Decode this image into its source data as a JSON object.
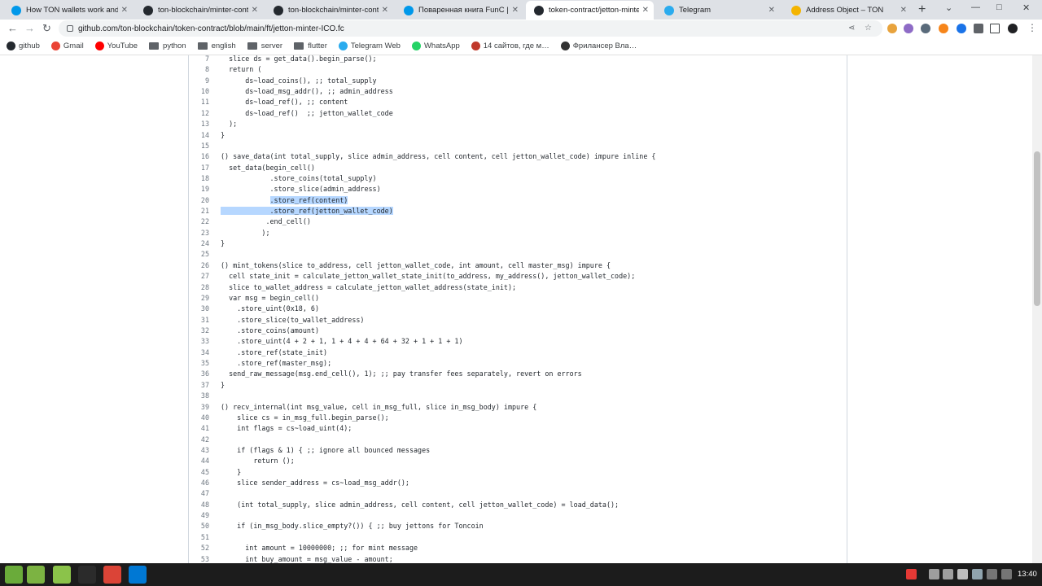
{
  "tabs": [
    {
      "title": "How TON wallets work and h…",
      "icon": "ton-icon",
      "color": "#0098ea",
      "active": false
    },
    {
      "title": "ton-blockchain/minter-contra…",
      "icon": "github-icon",
      "color": "#24292f",
      "active": false
    },
    {
      "title": "ton-blockchain/minter-contra…",
      "icon": "github-icon",
      "color": "#24292f",
      "active": false
    },
    {
      "title": "Поваренная книга FunC | От…",
      "icon": "ton-icon",
      "color": "#0098ea",
      "active": false
    },
    {
      "title": "token-contract/jetton-minter…",
      "icon": "github-icon",
      "color": "#24292f",
      "active": true
    },
    {
      "title": "Telegram",
      "icon": "telegram-icon",
      "color": "#2aabee",
      "active": false
    },
    {
      "title": "Address Object – TON",
      "icon": "hand-icon",
      "color": "#f4b400",
      "active": false
    }
  ],
  "url": "github.com/ton-blockchain/token-contract/blob/main/ft/jetton-minter-ICO.fc",
  "bookmarks": [
    {
      "label": "github",
      "icon": "github-icon",
      "color": "#24292f",
      "type": "site"
    },
    {
      "label": "Gmail",
      "icon": "gmail-icon",
      "color": "#ea4335",
      "type": "site"
    },
    {
      "label": "YouTube",
      "icon": "youtube-icon",
      "color": "#ff0000",
      "type": "site"
    },
    {
      "label": "python",
      "icon": "folder-icon",
      "color": "#5f6368",
      "type": "folder"
    },
    {
      "label": "english",
      "icon": "folder-icon",
      "color": "#5f6368",
      "type": "folder"
    },
    {
      "label": "server",
      "icon": "folder-icon",
      "color": "#5f6368",
      "type": "folder"
    },
    {
      "label": "flutter",
      "icon": "folder-icon",
      "color": "#5f6368",
      "type": "folder"
    },
    {
      "label": "Telegram Web",
      "icon": "telegram-icon",
      "color": "#2aabee",
      "type": "site"
    },
    {
      "label": "WhatsApp",
      "icon": "whatsapp-icon",
      "color": "#25d366",
      "type": "site"
    },
    {
      "label": "14 сайтов, где м…",
      "icon": "site-icon",
      "color": "#c0392b",
      "type": "site"
    },
    {
      "label": "Фрилансер Вла…",
      "icon": "site-icon",
      "color": "#333333",
      "type": "site"
    }
  ],
  "code_lines": [
    {
      "n": "7",
      "pre": "  slice ds = get_data().begin_parse();",
      "hl": "",
      "post": ""
    },
    {
      "n": "8",
      "pre": "  return (",
      "hl": "",
      "post": ""
    },
    {
      "n": "9",
      "pre": "      ds~load_coins(), ;; total_supply",
      "hl": "",
      "post": ""
    },
    {
      "n": "10",
      "pre": "      ds~load_msg_addr(), ;; admin_address",
      "hl": "",
      "post": ""
    },
    {
      "n": "11",
      "pre": "      ds~load_ref(), ;; content",
      "hl": "",
      "post": ""
    },
    {
      "n": "12",
      "pre": "      ds~load_ref()  ;; jetton_wallet_code",
      "hl": "",
      "post": ""
    },
    {
      "n": "13",
      "pre": "  );",
      "hl": "",
      "post": ""
    },
    {
      "n": "14",
      "pre": "}",
      "hl": "",
      "post": ""
    },
    {
      "n": "15",
      "pre": "",
      "hl": "",
      "post": ""
    },
    {
      "n": "16",
      "pre": "() save_data(int total_supply, slice admin_address, cell content, cell jetton_wallet_code) impure inline {",
      "hl": "",
      "post": ""
    },
    {
      "n": "17",
      "pre": "  set_data(begin_cell()",
      "hl": "",
      "post": ""
    },
    {
      "n": "18",
      "pre": "            .store_coins(total_supply)",
      "hl": "",
      "post": ""
    },
    {
      "n": "19",
      "pre": "            .store_slice(admin_address)",
      "hl": "",
      "post": ""
    },
    {
      "n": "20",
      "pre": "            ",
      "hl": ".store_ref(content)",
      "post": ""
    },
    {
      "n": "21",
      "pre": "",
      "hl": "            .store_ref(jetton_wallet_code)",
      "post": ""
    },
    {
      "n": "22",
      "pre": "           .end_cell()",
      "hl": "",
      "post": ""
    },
    {
      "n": "23",
      "pre": "          );",
      "hl": "",
      "post": ""
    },
    {
      "n": "24",
      "pre": "}",
      "hl": "",
      "post": ""
    },
    {
      "n": "25",
      "pre": "",
      "hl": "",
      "post": ""
    },
    {
      "n": "26",
      "pre": "() mint_tokens(slice to_address, cell jetton_wallet_code, int amount, cell master_msg) impure {",
      "hl": "",
      "post": ""
    },
    {
      "n": "27",
      "pre": "  cell state_init = calculate_jetton_wallet_state_init(to_address, my_address(), jetton_wallet_code);",
      "hl": "",
      "post": ""
    },
    {
      "n": "28",
      "pre": "  slice to_wallet_address = calculate_jetton_wallet_address(state_init);",
      "hl": "",
      "post": ""
    },
    {
      "n": "29",
      "pre": "  var msg = begin_cell()",
      "hl": "",
      "post": ""
    },
    {
      "n": "30",
      "pre": "    .store_uint(0x18, 6)",
      "hl": "",
      "post": ""
    },
    {
      "n": "31",
      "pre": "    .store_slice(to_wallet_address)",
      "hl": "",
      "post": ""
    },
    {
      "n": "32",
      "pre": "    .store_coins(amount)",
      "hl": "",
      "post": ""
    },
    {
      "n": "33",
      "pre": "    .store_uint(4 + 2 + 1, 1 + 4 + 4 + 64 + 32 + 1 + 1 + 1)",
      "hl": "",
      "post": ""
    },
    {
      "n": "34",
      "pre": "    .store_ref(state_init)",
      "hl": "",
      "post": ""
    },
    {
      "n": "35",
      "pre": "    .store_ref(master_msg);",
      "hl": "",
      "post": ""
    },
    {
      "n": "36",
      "pre": "  send_raw_message(msg.end_cell(), 1); ;; pay transfer fees separately, revert on errors",
      "hl": "",
      "post": ""
    },
    {
      "n": "37",
      "pre": "}",
      "hl": "",
      "post": ""
    },
    {
      "n": "38",
      "pre": "",
      "hl": "",
      "post": ""
    },
    {
      "n": "39",
      "pre": "() recv_internal(int msg_value, cell in_msg_full, slice in_msg_body) impure {",
      "hl": "",
      "post": ""
    },
    {
      "n": "40",
      "pre": "    slice cs = in_msg_full.begin_parse();",
      "hl": "",
      "post": ""
    },
    {
      "n": "41",
      "pre": "    int flags = cs~load_uint(4);",
      "hl": "",
      "post": ""
    },
    {
      "n": "42",
      "pre": "",
      "hl": "",
      "post": ""
    },
    {
      "n": "43",
      "pre": "    if (flags & 1) { ;; ignore all bounced messages",
      "hl": "",
      "post": ""
    },
    {
      "n": "44",
      "pre": "        return ();",
      "hl": "",
      "post": ""
    },
    {
      "n": "45",
      "pre": "    }",
      "hl": "",
      "post": ""
    },
    {
      "n": "46",
      "pre": "    slice sender_address = cs~load_msg_addr();",
      "hl": "",
      "post": ""
    },
    {
      "n": "47",
      "pre": "",
      "hl": "",
      "post": ""
    },
    {
      "n": "48",
      "pre": "    (int total_supply, slice admin_address, cell content, cell jetton_wallet_code) = load_data();",
      "hl": "",
      "post": ""
    },
    {
      "n": "49",
      "pre": "",
      "hl": "",
      "post": ""
    },
    {
      "n": "50",
      "pre": "    if (in_msg_body.slice_empty?()) { ;; buy jettons for Toncoin",
      "hl": "",
      "post": ""
    },
    {
      "n": "51",
      "pre": "",
      "hl": "",
      "post": ""
    },
    {
      "n": "52",
      "pre": "      int amount = 10000000; ;; for mint message",
      "hl": "",
      "post": ""
    },
    {
      "n": "53",
      "pre": "      int buy_amount = msg_value - amount;",
      "hl": "",
      "post": ""
    }
  ],
  "taskbar_apps": [
    {
      "name": "menu-app",
      "color": "#6aab3a"
    },
    {
      "name": "files-app",
      "color": "#7cb342"
    },
    {
      "name": "files-app-2",
      "color": "#8bc34a"
    },
    {
      "name": "terminal-app",
      "color": "#2b2b2b"
    },
    {
      "name": "chrome-app",
      "color": "#db4437"
    },
    {
      "name": "vscode-app",
      "color": "#0078d4"
    }
  ],
  "clock": "13:40"
}
